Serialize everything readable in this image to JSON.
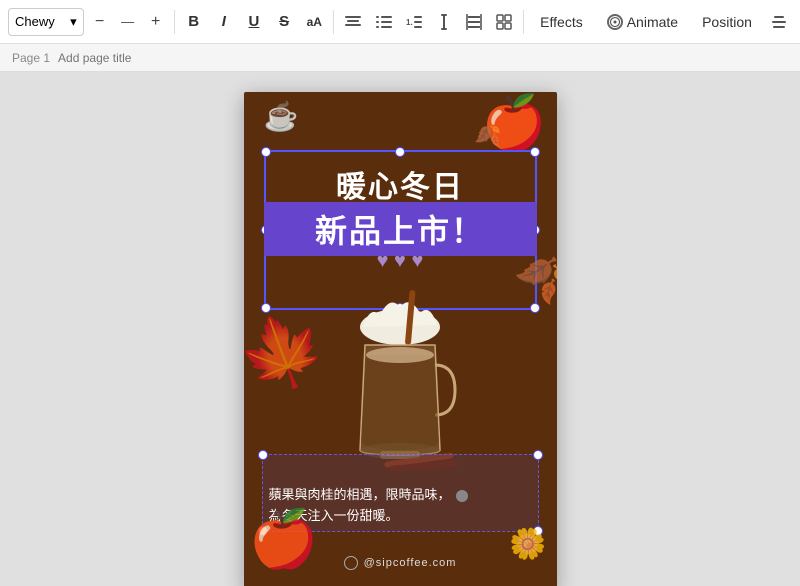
{
  "toolbar": {
    "font_name": "Chewy",
    "font_size_display": "—",
    "btn_minus": "−",
    "btn_plus": "+",
    "btn_bold": "B",
    "btn_italic": "I",
    "btn_underline": "U",
    "btn_strikethrough": "S",
    "btn_aa": "aA",
    "btn_align": "≡",
    "btn_list": "≡",
    "btn_list2": "≡",
    "btn_height": "↕",
    "btn_grid": "⊞",
    "effects_label": "Effects",
    "animate_label": "Animate",
    "position_label": "Position"
  },
  "page_bar": {
    "page_indicator": "Page 1",
    "page_title_placeholder": "Add page title"
  },
  "poster": {
    "heading1": "暖心冬日",
    "heading2": "新品上市！",
    "hearts": "♥ ♥ ♥",
    "body_text_line1": "蘋果與肉桂的相遇，限時品味，",
    "body_text_line2": "為冬天注入一份甜暖。",
    "website": "@sipcoffee.com",
    "background_color": "#5a2d0c"
  },
  "icons": {
    "font_name_chevron": "▾",
    "animate_circle": "◎",
    "more_icon": "⋮"
  }
}
